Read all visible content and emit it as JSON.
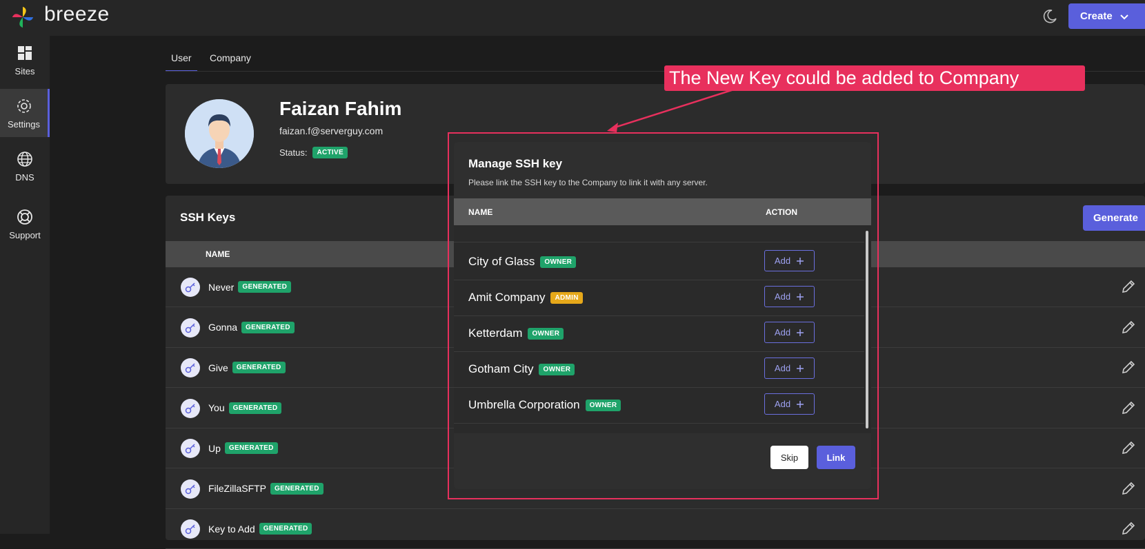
{
  "topbar": {
    "brand": "breeze",
    "create_label": "Create"
  },
  "sidebar": {
    "items": [
      {
        "label": "Sites",
        "icon": "grid-icon"
      },
      {
        "label": "Settings",
        "icon": "gear-icon"
      },
      {
        "label": "DNS",
        "icon": "globe-icon"
      },
      {
        "label": "Support",
        "icon": "lifebuoy-icon"
      }
    ]
  },
  "tabs": [
    "User",
    "Company"
  ],
  "profile": {
    "name": "Faizan Fahim",
    "email": "faizan.f@serverguy.com",
    "status_label": "Status:",
    "status": "ACTIVE"
  },
  "ssh": {
    "title": "SSH Keys",
    "generate_label": "Generate",
    "column_name": "NAME",
    "rows": [
      {
        "name": "Never",
        "badge": "GENERATED"
      },
      {
        "name": "Gonna",
        "badge": "GENERATED"
      },
      {
        "name": "Give",
        "badge": "GENERATED"
      },
      {
        "name": "You",
        "badge": "GENERATED"
      },
      {
        "name": "Up",
        "badge": "GENERATED"
      },
      {
        "name": "FileZillaSFTP",
        "badge": "GENERATED"
      },
      {
        "name": "Key to Add",
        "badge": "GENERATED"
      }
    ]
  },
  "annotation": {
    "callout": "The New Key could be added to Company",
    "color": "#e8305d"
  },
  "modal": {
    "title": "Manage SSH key",
    "subtitle": "Please link the SSH key to the Company to link it with any server.",
    "col_name": "NAME",
    "col_action": "ACTION",
    "add_label": "Add",
    "rows": [
      {
        "name": "City of Glass",
        "role": "OWNER"
      },
      {
        "name": "Amit Company",
        "role": "ADMIN"
      },
      {
        "name": "Ketterdam",
        "role": "OWNER"
      },
      {
        "name": "Gotham City",
        "role": "OWNER"
      },
      {
        "name": "Umbrella Corporation",
        "role": "OWNER"
      }
    ],
    "skip_label": "Skip",
    "link_label": "Link"
  },
  "colors": {
    "accent": "#5a5fdc",
    "success": "#1fa36a",
    "warning": "#e6a81a"
  }
}
